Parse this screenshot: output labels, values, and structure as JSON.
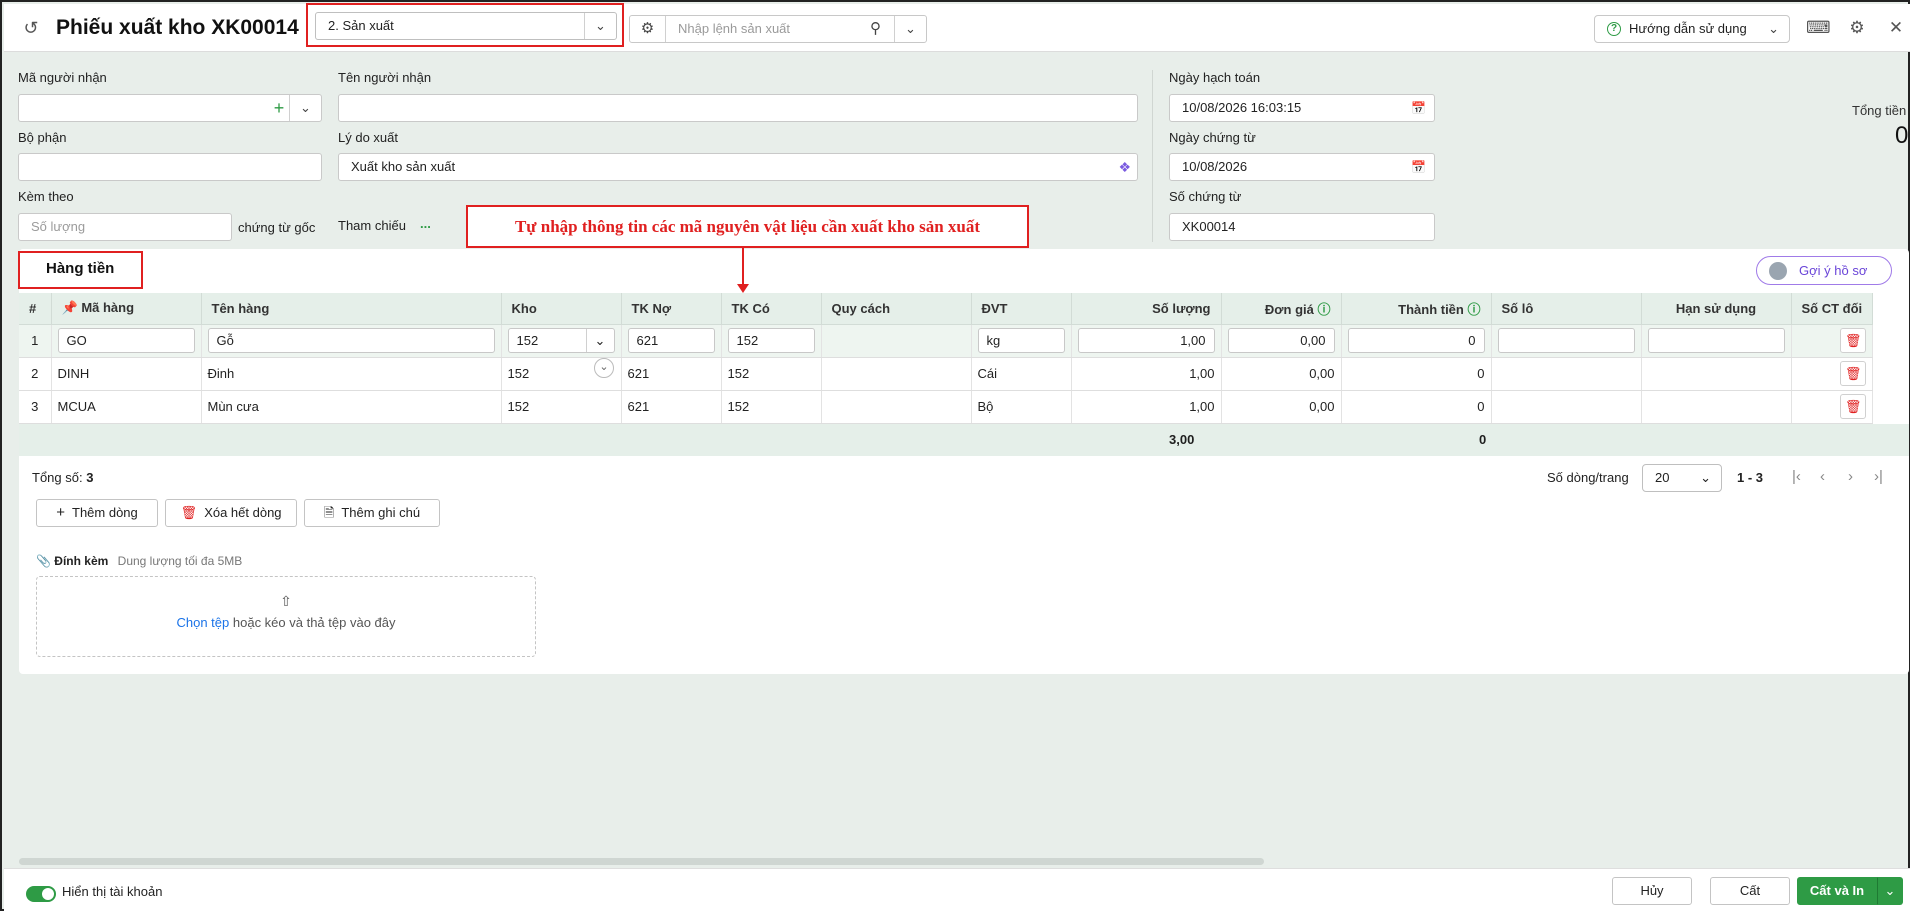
{
  "header": {
    "title": "Phiếu xuất kho XK00014",
    "type_select": "2. Sản xuất",
    "search_placeholder": "Nhập lệnh sản xuất",
    "guide_label": "Hướng dẫn sử dụng"
  },
  "form": {
    "ma_nguoi_nhan_label": "Mã người nhận",
    "ten_nguoi_nhan_label": "Tên người nhận",
    "bo_phan_label": "Bộ phận",
    "ly_do_xuat_label": "Lý do xuất",
    "ly_do_xuat_value": "Xuất kho sản xuất",
    "kem_theo_label": "Kèm theo",
    "so_luong_placeholder": "Số lượng",
    "chung_tu_goc_label": "chứng từ gốc",
    "tham_chieu_label": "Tham chiếu",
    "tham_chieu_value": "...",
    "ngay_hach_toan_label": "Ngày hạch toán",
    "ngay_hach_toan_value": "10/08/2026 16:03:15",
    "ngay_chung_tu_label": "Ngày chứng từ",
    "ngay_chung_tu_value": "10/08/2026",
    "so_chung_tu_label": "Số chứng từ",
    "so_chung_tu_value": "XK00014",
    "tong_tien_label": "Tổng tiền",
    "tong_tien_value": "0"
  },
  "section": {
    "tab_label": "Hàng tiền",
    "suggest_label": "Gợi ý hồ sơ"
  },
  "callout": "Tự nhập thông tin các mã nguyên vật liệu cần xuất kho sản xuất",
  "table": {
    "columns": [
      "#",
      "Mã hàng",
      "Tên hàng",
      "Kho",
      "TK Nợ",
      "TK Có",
      "Quy cách",
      "ĐVT",
      "Số lượng",
      "Đơn giá",
      "Thành tiền",
      "Số lô",
      "Hạn sử dụng",
      "Số CT đối"
    ],
    "rows": [
      {
        "no": "1",
        "ma": "GO",
        "ten": "Gỗ",
        "kho": "152",
        "no_tk": "621",
        "co_tk": "152",
        "quy_cach": "",
        "dvt": "kg",
        "so_luong": "1,00",
        "don_gia": "0,00",
        "thanh_tien": "0"
      },
      {
        "no": "2",
        "ma": "DINH",
        "ten": "Đinh",
        "kho": "152",
        "no_tk": "621",
        "co_tk": "152",
        "quy_cach": "",
        "dvt": "Cái",
        "so_luong": "1,00",
        "don_gia": "0,00",
        "thanh_tien": "0"
      },
      {
        "no": "3",
        "ma": "MCUA",
        "ten": "Mùn cưa",
        "kho": "152",
        "no_tk": "621",
        "co_tk": "152",
        "quy_cach": "",
        "dvt": "Bộ",
        "so_luong": "1,00",
        "don_gia": "0,00",
        "thanh_tien": "0"
      }
    ],
    "total_so_luong": "3,00",
    "total_thanh_tien": "0"
  },
  "pager": {
    "total_label": "Tổng số:",
    "total_value": "3",
    "rows_per_page_label": "Số dòng/trang",
    "rows_per_page": "20",
    "range": "1 - 3"
  },
  "actions": {
    "add_row": "Thêm dòng",
    "delete_all": "Xóa hết dòng",
    "add_note": "Thêm ghi chú"
  },
  "attach": {
    "label": "Đính kèm",
    "limit": "Dung lượng tối đa 5MB",
    "choose": "Chọn tệp",
    "drop_text": "hoặc kéo và thả tệp vào đây"
  },
  "footer": {
    "show_accounts": "Hiển thị tài khoản",
    "cancel": "Hủy",
    "save": "Cất",
    "save_print": "Cất và In"
  },
  "colors": {
    "accent": "#2e9b45",
    "danger": "#e02020",
    "link": "#1a73e8"
  }
}
